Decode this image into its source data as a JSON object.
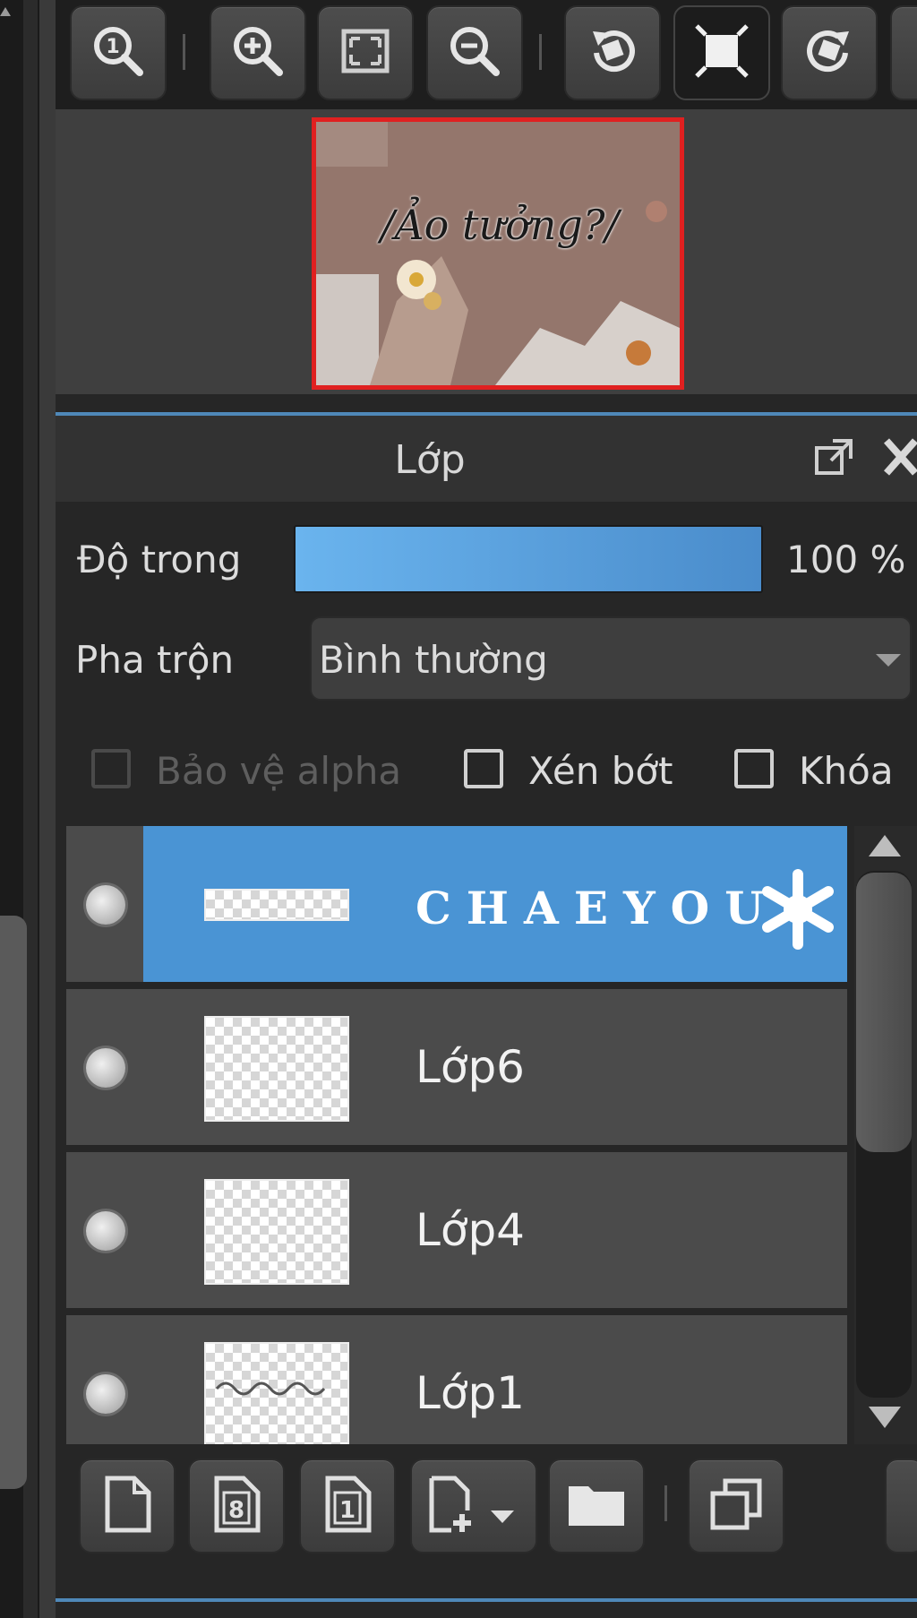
{
  "toolbar": {
    "buttons": [
      {
        "name": "zoom-actual-size",
        "icon": "zoom-1-icon"
      },
      {
        "name": "zoom-in",
        "icon": "zoom-in-icon"
      },
      {
        "name": "zoom-fit",
        "icon": "fit-screen-icon"
      },
      {
        "name": "zoom-out",
        "icon": "zoom-out-icon"
      },
      {
        "name": "rotate-left",
        "icon": "rotate-left-icon"
      },
      {
        "name": "fit-canvas",
        "icon": "fit-canvas-icon",
        "active": true
      },
      {
        "name": "rotate-right",
        "icon": "rotate-right-icon"
      }
    ]
  },
  "navigator": {
    "preview_text": "/Ảo tưởng?/",
    "frame_color": "#e02020"
  },
  "layer_panel": {
    "title": "Lớp",
    "opacity_label": "Độ trong",
    "opacity_value": "100 %",
    "opacity": 1.0,
    "blend_label": "Pha trộn",
    "blend_value": "Bình thường",
    "checkboxes": {
      "protect_alpha": {
        "label": "Bảo vệ alpha",
        "checked": false,
        "enabled": false
      },
      "clipping": {
        "label": "Xén bớt",
        "checked": false,
        "enabled": true
      },
      "lock": {
        "label": "Khóa",
        "checked": false,
        "enabled": true
      }
    },
    "layers": [
      {
        "name": "CHAEYOU",
        "selected": true,
        "visible": true
      },
      {
        "name": "Lớp6",
        "selected": false,
        "visible": true
      },
      {
        "name": "Lớp4",
        "selected": false,
        "visible": true
      },
      {
        "name": "Lớp1",
        "selected": false,
        "visible": true
      }
    ],
    "selection_color": "#4a94d4"
  },
  "bottom_bar": {
    "buttons": [
      {
        "name": "new-layer",
        "icon": "new-page-icon"
      },
      {
        "name": "new-8bit-layer",
        "icon": "page-8-icon"
      },
      {
        "name": "new-1bit-layer",
        "icon": "page-1-icon"
      },
      {
        "name": "add-layer-menu",
        "icon": "add-page-dropdown-icon"
      },
      {
        "name": "new-folder",
        "icon": "folder-icon"
      },
      {
        "name": "duplicate-layer",
        "icon": "duplicate-icon"
      }
    ]
  }
}
